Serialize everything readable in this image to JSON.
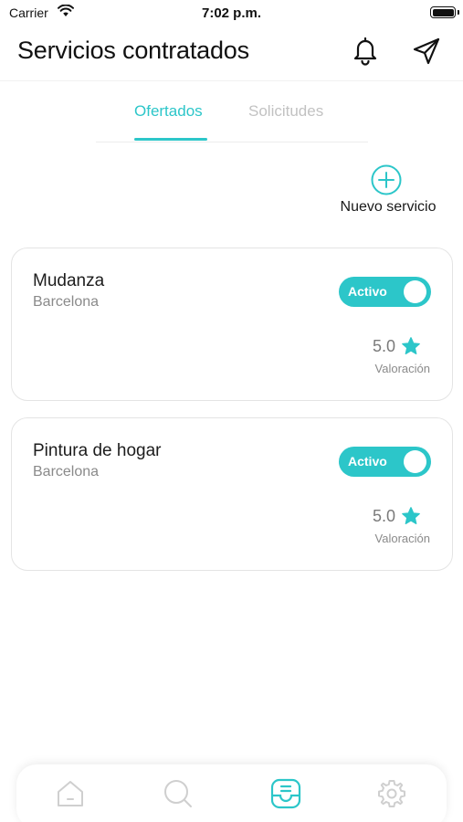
{
  "status_bar": {
    "carrier": "Carrier",
    "time": "7:02 p.m."
  },
  "header": {
    "title": "Servicios contratados",
    "icons": [
      "bell-icon",
      "paper-plane-icon"
    ]
  },
  "tabs": [
    {
      "label": "Ofertados",
      "active": true
    },
    {
      "label": "Solicitudes",
      "active": false
    }
  ],
  "new_service": {
    "label": "Nuevo servicio",
    "icon": "plus-circle-icon"
  },
  "services": [
    {
      "title": "Mudanza",
      "location": "Barcelona",
      "status": "Activo",
      "active": true,
      "rating": "5.0",
      "rating_caption": "Valoración"
    },
    {
      "title": "Pintura de hogar",
      "location": "Barcelona",
      "status": "Activo",
      "active": true,
      "rating": "5.0",
      "rating_caption": "Valoración"
    }
  ],
  "bottom_nav": [
    {
      "icon": "home-icon",
      "active": false
    },
    {
      "icon": "search-icon",
      "active": false
    },
    {
      "icon": "inbox-icon",
      "active": true
    },
    {
      "icon": "gear-icon",
      "active": false
    }
  ],
  "colors": {
    "accent": "#2cc6c9",
    "inactive_tab": "#c2c2c2",
    "inactive_icon": "#cfcfcf",
    "card_border": "#e4e4e4"
  }
}
